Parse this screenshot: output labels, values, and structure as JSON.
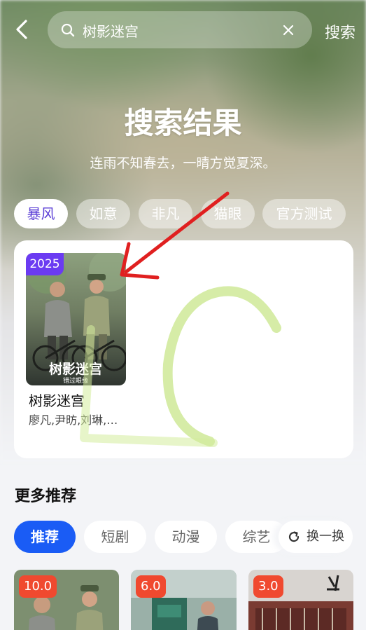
{
  "search": {
    "query": "树影迷宫",
    "button_label": "搜索"
  },
  "header": {
    "title": "搜索结果",
    "subtitle": "连雨不知春去，一晴方觉夏深。"
  },
  "source_tabs": [
    {
      "label": "暴风",
      "active": true
    },
    {
      "label": "如意",
      "active": false
    },
    {
      "label": "非凡",
      "active": false
    },
    {
      "label": "猫眼",
      "active": false
    },
    {
      "label": "官方测试",
      "active": false
    }
  ],
  "result": {
    "year": "2025",
    "title": "树影迷宫",
    "cast": "廖凡,尹昉,刘琳,…",
    "poster_text": "树影迷宫",
    "poster_subtext": "错过眼缘"
  },
  "more": {
    "title": "更多推荐",
    "tabs": [
      {
        "label": "推荐",
        "active": true
      },
      {
        "label": "短剧",
        "active": false
      },
      {
        "label": "动漫",
        "active": false
      },
      {
        "label": "综艺",
        "active": false
      }
    ],
    "refresh_label": "换一换",
    "cards": [
      {
        "score": "10.0"
      },
      {
        "score": "6.0"
      },
      {
        "score": "3.0"
      }
    ]
  },
  "colors": {
    "accent_purple": "#6b3bf2",
    "active_source": "#5b3fd6",
    "active_category": "#1a5cf5",
    "score_badge": "#f0492f",
    "annotation_arrow": "#e02020",
    "annotation_scribble": "#c8e68a"
  },
  "icons": {
    "back": "back-arrow-icon",
    "search": "search-icon",
    "clear": "close-icon",
    "refresh": "refresh-icon"
  }
}
